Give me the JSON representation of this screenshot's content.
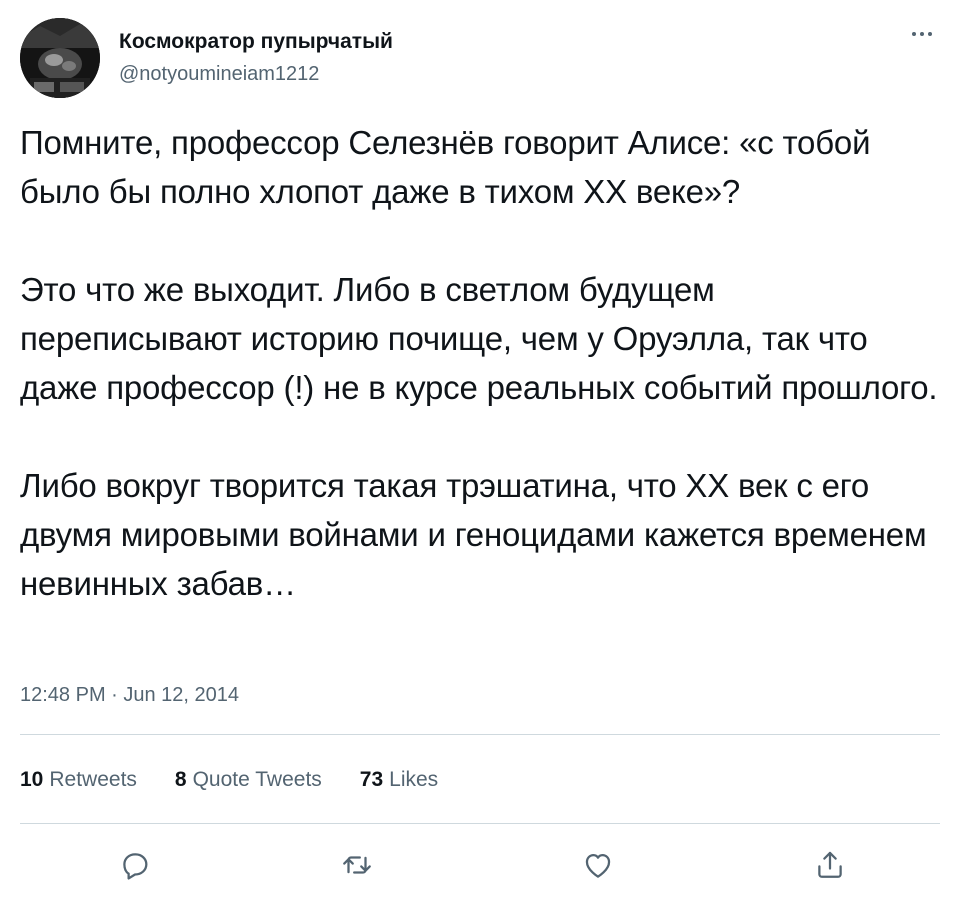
{
  "author": {
    "display_name": "Космократор пупырчатый",
    "handle": "@notyoumineiam1212",
    "avatar_icon": "avatar-image"
  },
  "tweet": {
    "paragraphs": [
      "Помните, профессор Селезнёв говорит Алисе: «с тобой было бы полно хлопот даже в тихом ХХ веке»?",
      "Это что же выходит. Либо в светлом будущем переписывают историю почище, чем у Оруэлла, так что даже профессор (!) не в курсе реальных событий прошлого.",
      "Либо вокруг творится такая трэшатина, что ХХ век с его двумя мировыми войнами и геноцидами кажется временем невинных забав…"
    ],
    "timestamp": "12:48 PM · Jun 12, 2014"
  },
  "stats": {
    "retweets": {
      "count": "10",
      "label": "Retweets"
    },
    "quote_tweets": {
      "count": "8",
      "label": "Quote Tweets"
    },
    "likes": {
      "count": "73",
      "label": "Likes"
    }
  },
  "actions": {
    "reply_icon": "reply-icon",
    "retweet_icon": "retweet-icon",
    "like_icon": "heart-icon",
    "share_icon": "share-icon"
  },
  "colors": {
    "text_primary": "#0f1419",
    "text_secondary": "#536471",
    "divider": "#cfd9de"
  }
}
